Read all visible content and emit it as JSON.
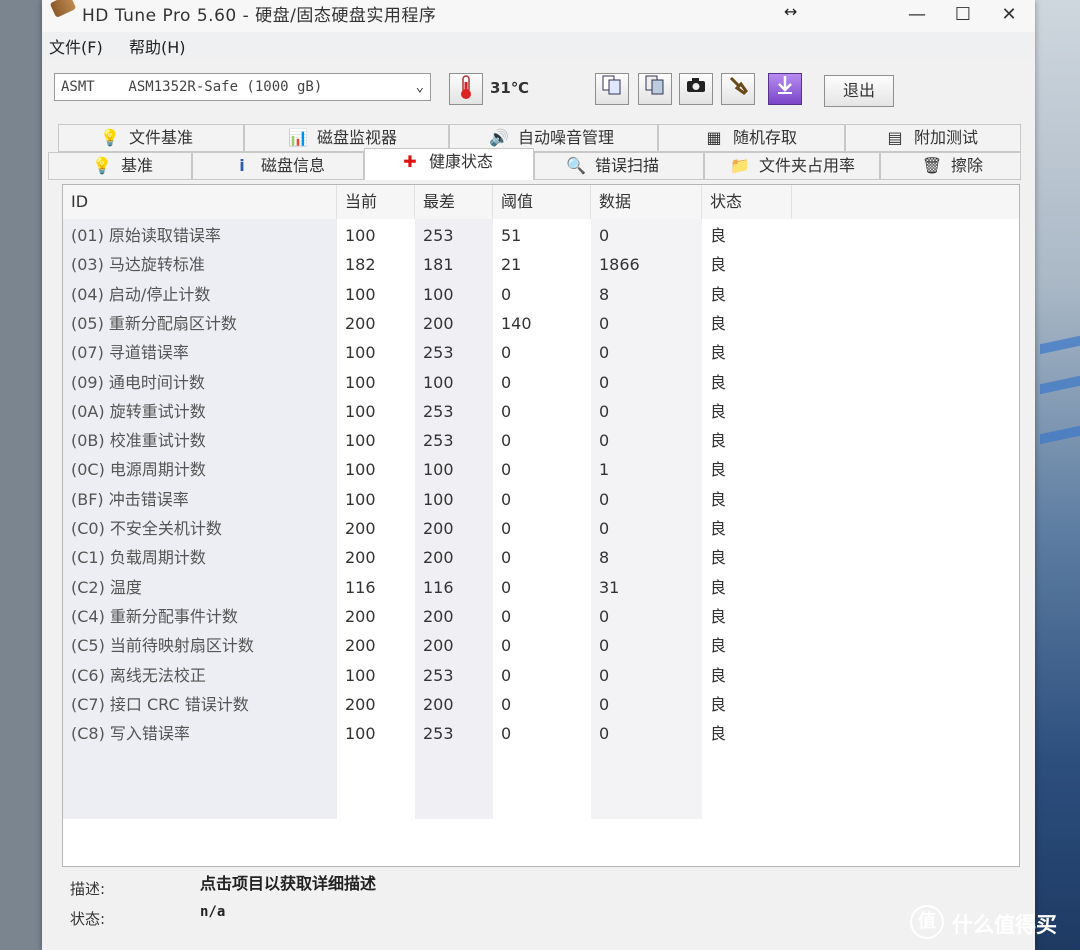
{
  "window": {
    "title": "HD Tune Pro 5.60 - 硬盘/固态硬盘实用程序",
    "resize_indicator": "↔",
    "minimize": "—",
    "maximize": "☐",
    "close": "✕"
  },
  "menu": {
    "file": "文件(F)",
    "help": "帮助(H)"
  },
  "toolbar": {
    "drive": "ASMT    ASM1352R-Safe (1000 gB)",
    "temperature": "31℃",
    "exit_label": "退出"
  },
  "tabs": {
    "row1": [
      "文件基准",
      "磁盘监视器",
      "自动噪音管理",
      "随机存取",
      "附加测试"
    ],
    "row2": [
      "基准",
      "磁盘信息",
      "健康状态",
      "错误扫描",
      "文件夹占用率",
      "擦除"
    ]
  },
  "table": {
    "headers": [
      "ID",
      "当前",
      "最差",
      "阈值",
      "数据",
      "状态"
    ],
    "rows": [
      [
        "(01) 原始读取错误率",
        "100",
        "253",
        "51",
        "0",
        "良"
      ],
      [
        "(03) 马达旋转标准",
        "182",
        "181",
        "21",
        "1866",
        "良"
      ],
      [
        "(04) 启动/停止计数",
        "100",
        "100",
        "0",
        "8",
        "良"
      ],
      [
        "(05) 重新分配扇区计数",
        "200",
        "200",
        "140",
        "0",
        "良"
      ],
      [
        "(07) 寻道错误率",
        "100",
        "253",
        "0",
        "0",
        "良"
      ],
      [
        "(09) 通电时间计数",
        "100",
        "100",
        "0",
        "0",
        "良"
      ],
      [
        "(0A) 旋转重试计数",
        "100",
        "253",
        "0",
        "0",
        "良"
      ],
      [
        "(0B) 校准重试计数",
        "100",
        "253",
        "0",
        "0",
        "良"
      ],
      [
        "(0C) 电源周期计数",
        "100",
        "100",
        "0",
        "1",
        "良"
      ],
      [
        "(BF) 冲击错误率",
        "100",
        "100",
        "0",
        "0",
        "良"
      ],
      [
        "(C0) 不安全关机计数",
        "200",
        "200",
        "0",
        "0",
        "良"
      ],
      [
        "(C1) 负载周期计数",
        "200",
        "200",
        "0",
        "8",
        "良"
      ],
      [
        "(C2) 温度",
        "116",
        "116",
        "0",
        "31",
        "良"
      ],
      [
        "(C4) 重新分配事件计数",
        "200",
        "200",
        "0",
        "0",
        "良"
      ],
      [
        "(C5) 当前待映射扇区计数",
        "200",
        "200",
        "0",
        "0",
        "良"
      ],
      [
        "(C6) 离线无法校正",
        "100",
        "253",
        "0",
        "0",
        "良"
      ],
      [
        "(C7) 接口 CRC 错误计数",
        "200",
        "200",
        "0",
        "0",
        "良"
      ],
      [
        "(C8) 写入错误率",
        "100",
        "253",
        "0",
        "0",
        "良"
      ]
    ]
  },
  "footer": {
    "desc_label": "描述:",
    "desc_value": "点击项目以获取详细描述",
    "status_label": "状态:",
    "status_value": "n/a"
  },
  "watermark": {
    "logo": "值",
    "text": "什么值得买"
  }
}
